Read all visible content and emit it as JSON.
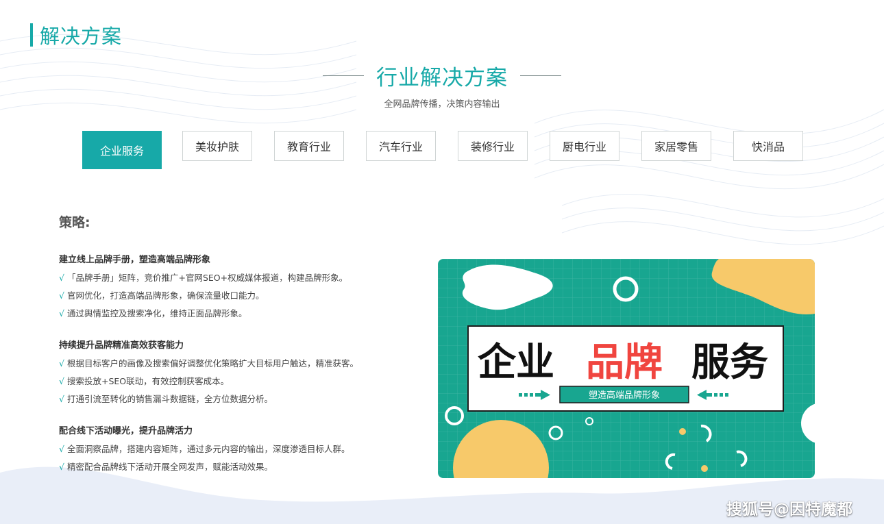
{
  "section": {
    "title": "解决方案"
  },
  "main": {
    "title": "行业解决方案",
    "subtitle": "全网品牌传播，决策内容输出"
  },
  "tabs": [
    {
      "label": "企业服务",
      "active": true
    },
    {
      "label": "美妆护肤",
      "active": false
    },
    {
      "label": "教育行业",
      "active": false
    },
    {
      "label": "汽车行业",
      "active": false
    },
    {
      "label": "装修行业",
      "active": false
    },
    {
      "label": "厨电行业",
      "active": false
    },
    {
      "label": "家居零售",
      "active": false
    },
    {
      "label": "快消品",
      "active": false
    }
  ],
  "strategy": {
    "heading": "策略:",
    "check_mark": "√",
    "groups": [
      {
        "title": "建立线上品牌手册，塑造高端品牌形象",
        "items": [
          "「品牌手册」矩阵，竞价推广+官网SEO+权威媒体报道，构建品牌形象。",
          "官网优化，打造高端品牌形象，确保流量收口能力。",
          "通过舆情监控及搜索净化，维持正面品牌形象。"
        ]
      },
      {
        "title": "持续提升品牌精准高效获客能力",
        "items": [
          "根据目标客户的画像及搜索偏好调整优化策略扩大目标用户触达，精准获客。",
          "搜索投放+SEO联动，有效控制获客成本。",
          "打通引流至转化的销售漏斗数据链，全方位数据分析。"
        ]
      },
      {
        "title": "配合线下活动曝光，提升品牌活力",
        "items": [
          "全面洞察品牌，搭建内容矩阵，通过多元内容的输出，深度渗透目标人群。",
          "精密配合品牌线下活动开展全网发声，赋能活动效果。"
        ]
      }
    ]
  },
  "banner": {
    "word1": "企业",
    "word2": "品牌",
    "word3": "服务",
    "tagline": "塑造高端品牌形象",
    "colors": {
      "bg": "#18a690",
      "accent_red": "#f0453f",
      "accent_yellow": "#f7c96a"
    }
  },
  "watermark": "搜狐号@因特魔都",
  "colors": {
    "accent": "#17a9a8"
  }
}
